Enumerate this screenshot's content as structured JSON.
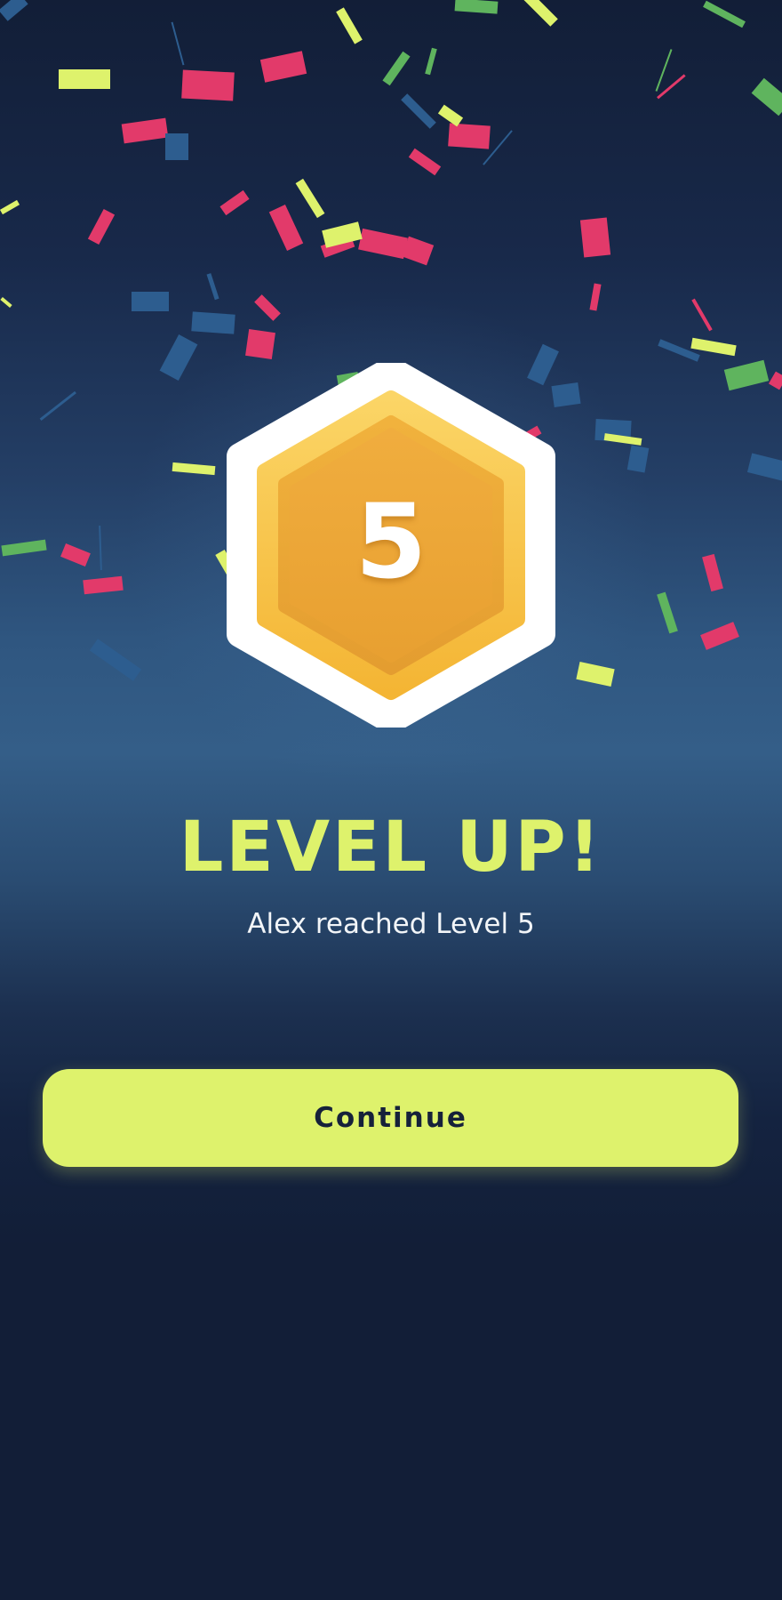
{
  "colors": {
    "accent_lime": "#def26c",
    "background_dark": "#121e37",
    "badge_gold_light": "#f8c84a",
    "badge_gold_dark": "#e8a532",
    "confetti_red": "#e23a6a",
    "confetti_blue": "#2d5d8f",
    "confetti_green": "#5fb45e",
    "confetti_lime": "#def26c",
    "text_white": "#f2f5f8"
  },
  "badge": {
    "level_number": "5",
    "icon": "hexagon-level-badge-icon"
  },
  "headline": "LEVEL UP!",
  "subtitle": "Alex reached Level 5",
  "continue_button": {
    "label": "Continue"
  }
}
